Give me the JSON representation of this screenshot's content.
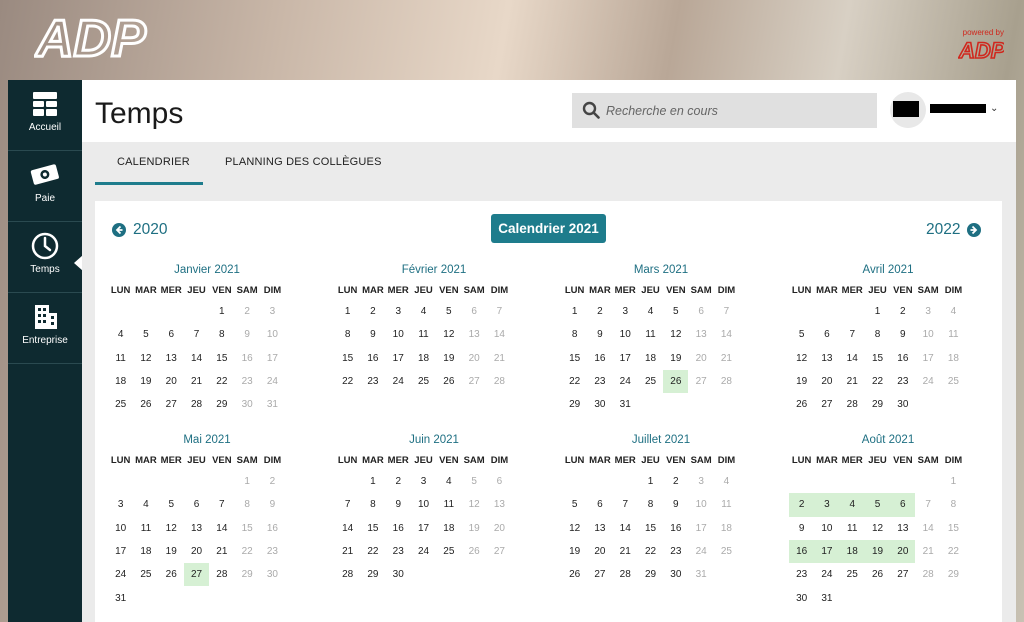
{
  "brand": {
    "logo_text": "ADP",
    "powered_by": "powered by",
    "powered_logo": "ADP"
  },
  "sidebar": {
    "items": [
      {
        "label": "Accueil",
        "icon": "home-grid-icon"
      },
      {
        "label": "Paie",
        "icon": "money-icon"
      },
      {
        "label": "Temps",
        "icon": "clock-icon",
        "active": true
      },
      {
        "label": "Entreprise",
        "icon": "building-icon"
      }
    ]
  },
  "header": {
    "title": "Temps",
    "search_placeholder": "Recherche en cours"
  },
  "tabs": [
    {
      "label": "CALENDRIER",
      "active": true
    },
    {
      "label": "PLANNING DES COLLÈGUES"
    }
  ],
  "calendar": {
    "prev_year": "2020",
    "next_year": "2022",
    "current_label": "Calendrier 2021",
    "weekdays": [
      "LUN",
      "MAR",
      "MER",
      "JEU",
      "VEN",
      "SAM",
      "DIM"
    ],
    "months": [
      {
        "name": "Janvier 2021",
        "offset": 4,
        "days": 31,
        "highlighted": []
      },
      {
        "name": "Février 2021",
        "offset": 0,
        "days": 28,
        "highlighted": []
      },
      {
        "name": "Mars 2021",
        "offset": 0,
        "days": 31,
        "highlighted": [
          26
        ]
      },
      {
        "name": "Avril 2021",
        "offset": 3,
        "days": 30,
        "highlighted": []
      },
      {
        "name": "Mai 2021",
        "offset": 5,
        "days": 31,
        "highlighted": [
          27
        ]
      },
      {
        "name": "Juin 2021",
        "offset": 1,
        "days": 30,
        "highlighted": []
      },
      {
        "name": "Juillet 2021",
        "offset": 3,
        "days": 31,
        "highlighted": []
      },
      {
        "name": "Août 2021",
        "offset": 6,
        "days": 31,
        "highlighted": [
          2,
          3,
          4,
          5,
          6,
          16,
          17,
          18,
          19,
          20
        ]
      }
    ]
  },
  "colors": {
    "accent": "#1e7c8c",
    "sidebar": "#0e2a30",
    "highlight": "#d6f0d4",
    "brand_red": "#d0271d"
  }
}
